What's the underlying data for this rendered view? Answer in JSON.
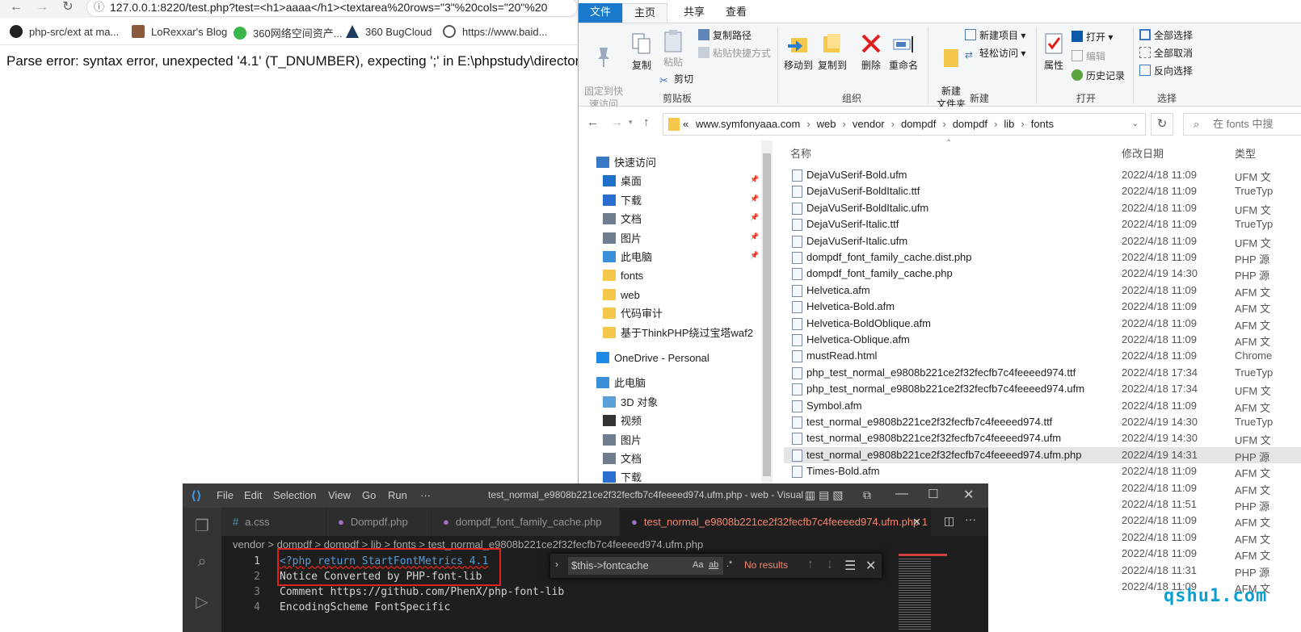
{
  "browser": {
    "url": "127.0.0.1:8220/test.php?test=<h1>aaaa</h1><textarea%20rows=\"3\"%20cols=\"20\"%20",
    "bookmarks": [
      "php-src/ext at ma...",
      "LoRexxar's Blog",
      "360网络空间资产...",
      "360 BugCloud",
      "https://www.baid..."
    ],
    "page_text": "Parse error: syntax error, unexpected '4.1' (T_DNUMBER), expecting ';' in E:\\phpstudy\\directory\\"
  },
  "explorer": {
    "tabs": [
      "文件",
      "主页",
      "共享",
      "查看"
    ],
    "ribbon": {
      "clipboard": {
        "pin": "固定到快\n速访问",
        "copy": "复制",
        "paste": "粘贴",
        "copy_path": "复制路径",
        "paste_shortcut": "粘贴快捷方式",
        "cut": "剪切",
        "label": "剪贴板"
      },
      "organize": {
        "move_to": "移动到",
        "copy_to": "复制到",
        "delete": "删除",
        "rename": "重命名",
        "label": "组织"
      },
      "new": {
        "new_folder": "新建\n文件夹",
        "new_item": "新建项目",
        "easy_access": "轻松访问",
        "label": "新建"
      },
      "open": {
        "properties": "属性",
        "open": "打开",
        "edit": "编辑",
        "history": "历史记录",
        "label": "打开"
      },
      "select": {
        "select_all": "全部选择",
        "select_none": "全部取消",
        "invert": "反向选择",
        "label": "选择"
      }
    },
    "address": {
      "prefix": "«",
      "crumbs": [
        "www.symfonyaaa.com",
        "web",
        "vendor",
        "dompdf",
        "dompdf",
        "lib",
        "fonts"
      ]
    },
    "search_placeholder": "在 fonts 中搜",
    "nav": [
      {
        "label": "快速访问",
        "pinned": false
      },
      {
        "label": "桌面",
        "pinned": true
      },
      {
        "label": "下载",
        "pinned": true
      },
      {
        "label": "文档",
        "pinned": true
      },
      {
        "label": "图片",
        "pinned": true
      },
      {
        "label": "此电脑",
        "pinned": true
      },
      {
        "label": "fonts",
        "pinned": false
      },
      {
        "label": "web",
        "pinned": false
      },
      {
        "label": "代码审计",
        "pinned": false
      },
      {
        "label": "基于ThinkPHP绕过宝塔waf2",
        "pinned": false
      },
      {
        "label": "OneDrive - Personal",
        "pinned": false
      },
      {
        "label": "此电脑",
        "pinned": false
      },
      {
        "label": "3D 对象",
        "pinned": false
      },
      {
        "label": "视频",
        "pinned": false
      },
      {
        "label": "图片",
        "pinned": false
      },
      {
        "label": "文档",
        "pinned": false
      },
      {
        "label": "下载",
        "pinned": false
      }
    ],
    "columns": {
      "name": "名称",
      "date": "修改日期",
      "type": "类型"
    },
    "files": [
      {
        "name": "DejaVuSerif-Bold.ufm",
        "date": "2022/4/18 11:09",
        "type": "UFM 文"
      },
      {
        "name": "DejaVuSerif-BoldItalic.ttf",
        "date": "2022/4/18 11:09",
        "type": "TrueTyp"
      },
      {
        "name": "DejaVuSerif-BoldItalic.ufm",
        "date": "2022/4/18 11:09",
        "type": "UFM 文"
      },
      {
        "name": "DejaVuSerif-Italic.ttf",
        "date": "2022/4/18 11:09",
        "type": "TrueTyp"
      },
      {
        "name": "DejaVuSerif-Italic.ufm",
        "date": "2022/4/18 11:09",
        "type": "UFM 文"
      },
      {
        "name": "dompdf_font_family_cache.dist.php",
        "date": "2022/4/18 11:09",
        "type": "PHP 源"
      },
      {
        "name": "dompdf_font_family_cache.php",
        "date": "2022/4/19 14:30",
        "type": "PHP 源"
      },
      {
        "name": "Helvetica.afm",
        "date": "2022/4/18 11:09",
        "type": "AFM 文"
      },
      {
        "name": "Helvetica-Bold.afm",
        "date": "2022/4/18 11:09",
        "type": "AFM 文"
      },
      {
        "name": "Helvetica-BoldOblique.afm",
        "date": "2022/4/18 11:09",
        "type": "AFM 文"
      },
      {
        "name": "Helvetica-Oblique.afm",
        "date": "2022/4/18 11:09",
        "type": "AFM 文"
      },
      {
        "name": "mustRead.html",
        "date": "2022/4/18 11:09",
        "type": "Chrome"
      },
      {
        "name": "php_test_normal_e9808b221ce2f32fecfb7c4feeeed974.ttf",
        "date": "2022/4/18 17:34",
        "type": "TrueTyp"
      },
      {
        "name": "php_test_normal_e9808b221ce2f32fecfb7c4feeeed974.ufm",
        "date": "2022/4/18 17:34",
        "type": "UFM 文"
      },
      {
        "name": "Symbol.afm",
        "date": "2022/4/18 11:09",
        "type": "AFM 文"
      },
      {
        "name": "test_normal_e9808b221ce2f32fecfb7c4feeeed974.ttf",
        "date": "2022/4/19 14:30",
        "type": "TrueTyp"
      },
      {
        "name": "test_normal_e9808b221ce2f32fecfb7c4feeeed974.ufm",
        "date": "2022/4/19 14:30",
        "type": "UFM 文"
      },
      {
        "name": "test_normal_e9808b221ce2f32fecfb7c4feeeed974.ufm.php",
        "date": "2022/4/19 14:31",
        "type": "PHP 源"
      },
      {
        "name": "Times-Bold.afm",
        "date": "2022/4/18 11:09",
        "type": "AFM 文"
      },
      {
        "name": "",
        "date": "2022/4/18 11:09",
        "type": "AFM 文"
      },
      {
        "name": "",
        "date": "2022/4/18 11:51",
        "type": "PHP 源"
      },
      {
        "name": "",
        "date": "2022/4/18 11:09",
        "type": "AFM 文"
      },
      {
        "name": "",
        "date": "2022/4/18 11:09",
        "type": "AFM 文"
      },
      {
        "name": "",
        "date": "2022/4/18 11:09",
        "type": "AFM 文"
      },
      {
        "name": "",
        "date": "2022/4/18 11:31",
        "type": "PHP 源"
      },
      {
        "name": "",
        "date": "2022/4/18 11:09",
        "type": "AFM 文"
      }
    ]
  },
  "vscode": {
    "menus": [
      "File",
      "Edit",
      "Selection",
      "View",
      "Go",
      "Run",
      "···"
    ],
    "title": "test_normal_e9808b221ce2f32fecfb7c4feeeed974.ufm.php - web - Visual ...",
    "tabs": [
      "a.css",
      "Dompdf.php",
      "dompdf_font_family_cache.php",
      "test_normal_e9808b221ce2f32fecfb7c4feeeed974.ufm.php 1"
    ],
    "breadcrumb": "vendor > dompdf > dompdf > lib > fonts > test_normal_e9808b221ce2f32fecfb7c4feeeed974.ufm.php",
    "lines": [
      {
        "num": "1",
        "code": "<?php return StartFontMetrics 4.1"
      },
      {
        "num": "2",
        "code": "Notice Converted by PHP-font-lib"
      },
      {
        "num": "3",
        "code": "Comment https://github.com/PhenX/php-font-lib"
      },
      {
        "num": "4",
        "code": "EncodingScheme FontSpecific"
      }
    ],
    "find": {
      "query": "$this->fontcache",
      "options": [
        "Aa",
        "ab",
        ".*"
      ],
      "result": "No results"
    }
  },
  "watermark": "qshu1.com",
  "colors": {
    "accent": "#1979ca",
    "highlight": "#e0201b",
    "watermark": "#0aa0d4"
  }
}
